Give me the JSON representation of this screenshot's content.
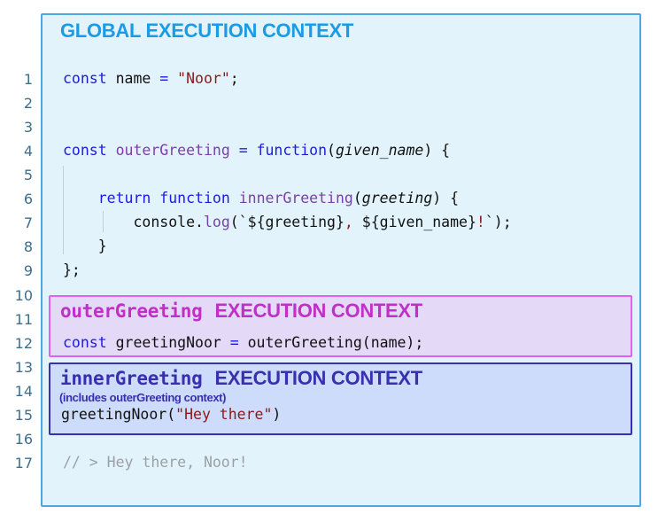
{
  "global_title": "GLOBAL EXECUTION CONTEXT",
  "outer_context": {
    "name": "outerGreeting",
    "label": "EXECUTION CONTEXT"
  },
  "inner_context": {
    "name": "innerGreeting",
    "label": "EXECUTION CONTEXT",
    "note": "(includes outerGreeting context)"
  },
  "colors": {
    "global": "#1a9be6",
    "outer": "#c030c8",
    "inner": "#3a2fb0"
  },
  "lines": [
    {
      "n": "1",
      "tokens": [
        [
          "kw",
          "const "
        ],
        [
          "pl",
          "name "
        ],
        [
          "kw",
          "= "
        ],
        [
          "str",
          "\"Noor\""
        ],
        [
          "pl",
          ";"
        ]
      ]
    },
    {
      "n": "2",
      "tokens": []
    },
    {
      "n": "3",
      "tokens": []
    },
    {
      "n": "4",
      "tokens": [
        [
          "kw",
          "const "
        ],
        [
          "fn",
          "outerGreeting "
        ],
        [
          "kw",
          "= function"
        ],
        [
          "pl",
          "("
        ],
        [
          "param",
          "given_name"
        ],
        [
          "pl",
          ") {"
        ]
      ]
    },
    {
      "n": "5",
      "tokens": []
    },
    {
      "n": "6",
      "tokens": [
        [
          "pl",
          "    "
        ],
        [
          "kw",
          "return function "
        ],
        [
          "fn",
          "innerGreeting"
        ],
        [
          "pl",
          "("
        ],
        [
          "param",
          "greeting"
        ],
        [
          "pl",
          ") {"
        ]
      ]
    },
    {
      "n": "7",
      "tokens": [
        [
          "pl",
          "        console."
        ],
        [
          "fn",
          "log"
        ],
        [
          "pl",
          "(`${greeting}"
        ],
        [
          "str",
          ", "
        ],
        [
          "pl",
          "${given_name}"
        ],
        [
          "str",
          "!"
        ],
        [
          "pl",
          "`);"
        ]
      ]
    },
    {
      "n": "8",
      "tokens": [
        [
          "pl",
          "    }"
        ]
      ]
    },
    {
      "n": "9",
      "tokens": [
        [
          "pl",
          "};"
        ]
      ]
    },
    {
      "n": "10",
      "tokens": []
    },
    {
      "n": "11",
      "tokens": []
    },
    {
      "n": "12",
      "tokens": [
        [
          "kw",
          "const "
        ],
        [
          "pl",
          "greetingNoor "
        ],
        [
          "kw",
          "= "
        ],
        [
          "pl",
          "outerGreeting(name);"
        ]
      ]
    },
    {
      "n": "13",
      "tokens": []
    },
    {
      "n": "14",
      "tokens": []
    },
    {
      "n": "15",
      "tokens": [
        [
          "pl",
          "greetingNoor("
        ],
        [
          "str",
          "\"Hey there\""
        ],
        [
          "pl",
          ")"
        ]
      ]
    },
    {
      "n": "16",
      "tokens": []
    },
    {
      "n": "17",
      "tokens": [
        [
          "cm",
          "// > Hey there, Noor!"
        ]
      ]
    }
  ]
}
